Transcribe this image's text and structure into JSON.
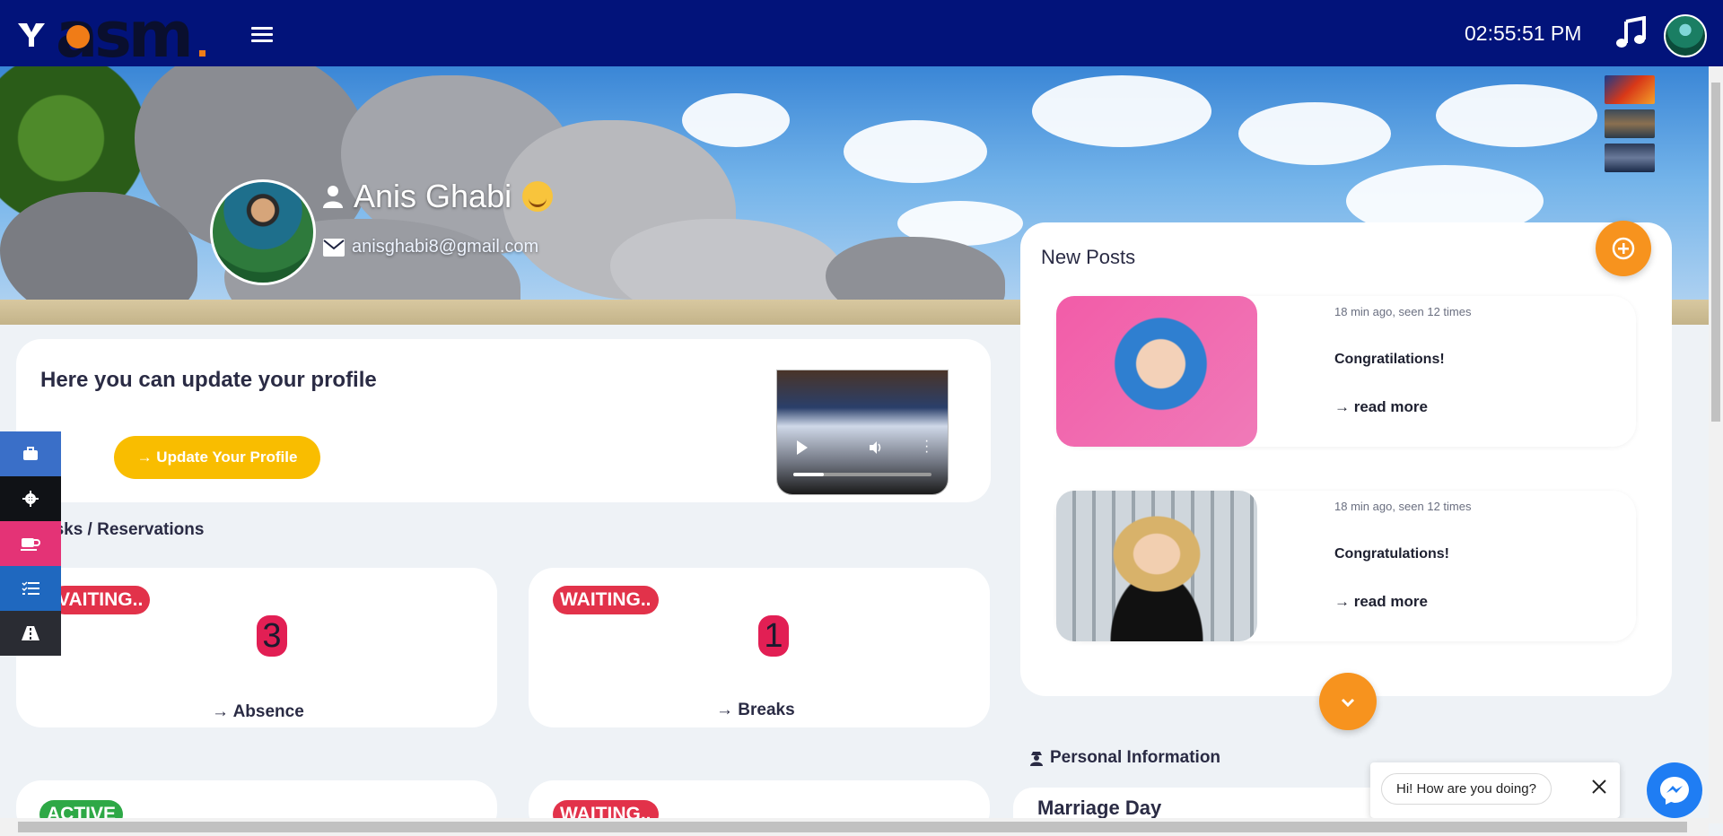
{
  "header": {
    "time": "02:55:51 PM"
  },
  "profile": {
    "name": "Anis Ghabi",
    "email": "anisghabi8@gmail.com"
  },
  "update_card": {
    "title": "Here you can update your profile",
    "button_label": "→ Update Your Profile"
  },
  "tasks": {
    "section_title": "asks / Reservations",
    "items": [
      {
        "status": "VAITING..",
        "count": "3",
        "link": "→ Absence"
      },
      {
        "status": "WAITING..",
        "count": "1",
        "link": "→ Breaks"
      },
      {
        "status": "ACTIVE",
        "count": "",
        "link": ""
      },
      {
        "status": "WAITING..",
        "count": "",
        "link": ""
      }
    ]
  },
  "posts": {
    "title": "New Posts",
    "items": [
      {
        "meta": "18 min ago, seen 12 times",
        "title": "Congratilations!",
        "link": "→ read more"
      },
      {
        "meta": "18 min ago, seen 12 times",
        "title": "Congratulations!",
        "link": "→ read more"
      }
    ]
  },
  "personal": {
    "title": "Personal Information",
    "card_title": "Marriage Day"
  },
  "chat": {
    "greeting": "Hi! How are you doing?"
  },
  "colors": {
    "topbar": "#02137a",
    "accent_orange": "#f7931e",
    "button_yellow": "#f9bd00",
    "badge_red": "#e2324a",
    "badge_green": "#2ea846",
    "count_pink": "#e21f54",
    "messenger_blue": "#1f7df3"
  },
  "dock_icons": [
    "briefcase-icon",
    "gear-icon",
    "coffee-icon",
    "task-list-icon",
    "road-icon"
  ]
}
